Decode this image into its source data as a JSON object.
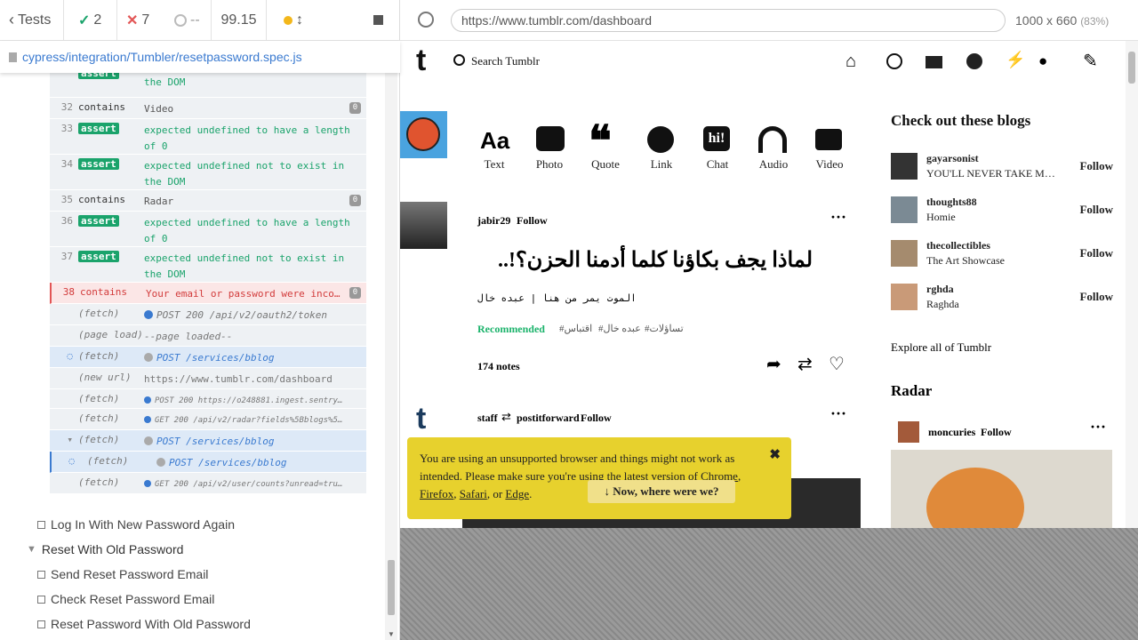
{
  "runner": {
    "tests_label": "Tests",
    "passed": "2",
    "failed": "7",
    "pending": "--",
    "duration": "99.15",
    "spec_path": "cypress/integration/Tumbler/resetpassword.spec.js"
  },
  "commands": [
    {
      "num": "32",
      "name": "contains",
      "msg": "Video",
      "count": "0"
    },
    {
      "num": "33",
      "name": "assert",
      "msg": "expected undefined to have a length of 0"
    },
    {
      "num": "34",
      "name": "assert",
      "msg": "expected undefined not to exist in the DOM"
    },
    {
      "num": "35",
      "name": "contains",
      "msg": "Radar",
      "count": "0"
    },
    {
      "num": "36",
      "name": "assert",
      "msg": "expected undefined to have a length of 0"
    },
    {
      "num": "37",
      "name": "assert",
      "msg": "expected undefined not to exist in the DOM"
    },
    {
      "num": "38",
      "name": "contains",
      "msg": "Your email or password were inco…",
      "count": "0"
    },
    {
      "name": "(fetch)",
      "msg": "POST 200 /api/v2/oauth2/token"
    },
    {
      "name": "(page load)",
      "msg": "--page loaded--"
    },
    {
      "name": "(fetch)",
      "msg": "POST /services/bblog"
    },
    {
      "name": "(new url)",
      "msg": "https://www.tumblr.com/dashboard"
    },
    {
      "name": "(fetch)",
      "msg": "POST 200 https://o248881.ingest.sentry…"
    },
    {
      "name": "(fetch)",
      "msg": "GET 200 /api/v2/radar?fields%5Bblogs%5…"
    },
    {
      "name": "(fetch)",
      "msg": "POST /services/bblog"
    },
    {
      "name": "(fetch)",
      "msg": "POST /services/bblog"
    },
    {
      "name": "(fetch)",
      "msg": "GET 200 /api/v2/user/counts?unread=tru…"
    }
  ],
  "assert_label": "assert",
  "top_partial": {
    "msg": "expected undefined not to exist in the DOM"
  },
  "tests": {
    "login_again": "Log In With New Password Again",
    "suite": "Reset With Old Password",
    "send_email": "Send Reset Password Email",
    "check_email": "Check Reset Password Email",
    "reset_old": "Reset Password With Old Password"
  },
  "browser": {
    "url": "https://www.tumblr.com/dashboard",
    "viewport": "1000 x 660",
    "zoom": "(83%)"
  },
  "tumblr": {
    "logo": "t",
    "search": "Search Tumblr",
    "post_types": [
      "Text",
      "Photo",
      "Quote",
      "Link",
      "Chat",
      "Audio",
      "Video"
    ],
    "post1": {
      "user": "jabir29",
      "follow": "Follow",
      "quote": "لماذا يجف بكاؤنا كلما أدمنا الحزن؟!..",
      "source": "الموت يمر من هنا | عبده خال",
      "recommended": "Recommended",
      "tags": [
        "#تساؤلات",
        "#عبده خال",
        "#اقتباس"
      ],
      "notes": "174 notes"
    },
    "post2": {
      "user": "staff",
      "reblog_from": "postitforward",
      "follow": "Follow"
    },
    "sidebar": {
      "title": "Check out these blogs",
      "blogs": [
        {
          "name": "gayarsonist",
          "desc": "YOU'LL NEVER TAKE M…",
          "follow": "Follow"
        },
        {
          "name": "thoughts88",
          "desc": "Homie",
          "follow": "Follow"
        },
        {
          "name": "thecollectibles",
          "desc": "The Art Showcase",
          "follow": "Follow"
        },
        {
          "name": "rghda",
          "desc": "Raghda",
          "follow": "Follow"
        }
      ],
      "explore": "Explore all of Tumblr",
      "radar_title": "Radar",
      "radar_user": "moncuries",
      "radar_follow": "Follow"
    },
    "banner": {
      "line1": "You are using an unsupported browser and things might not work as intended. Please make sure you're using the latest version of ",
      "chrome": "Chrome",
      "firefox": "Firefox",
      "safari": "Safari",
      "or": ", or ",
      "edge": "Edge",
      "button": "Now, where were we?"
    }
  }
}
